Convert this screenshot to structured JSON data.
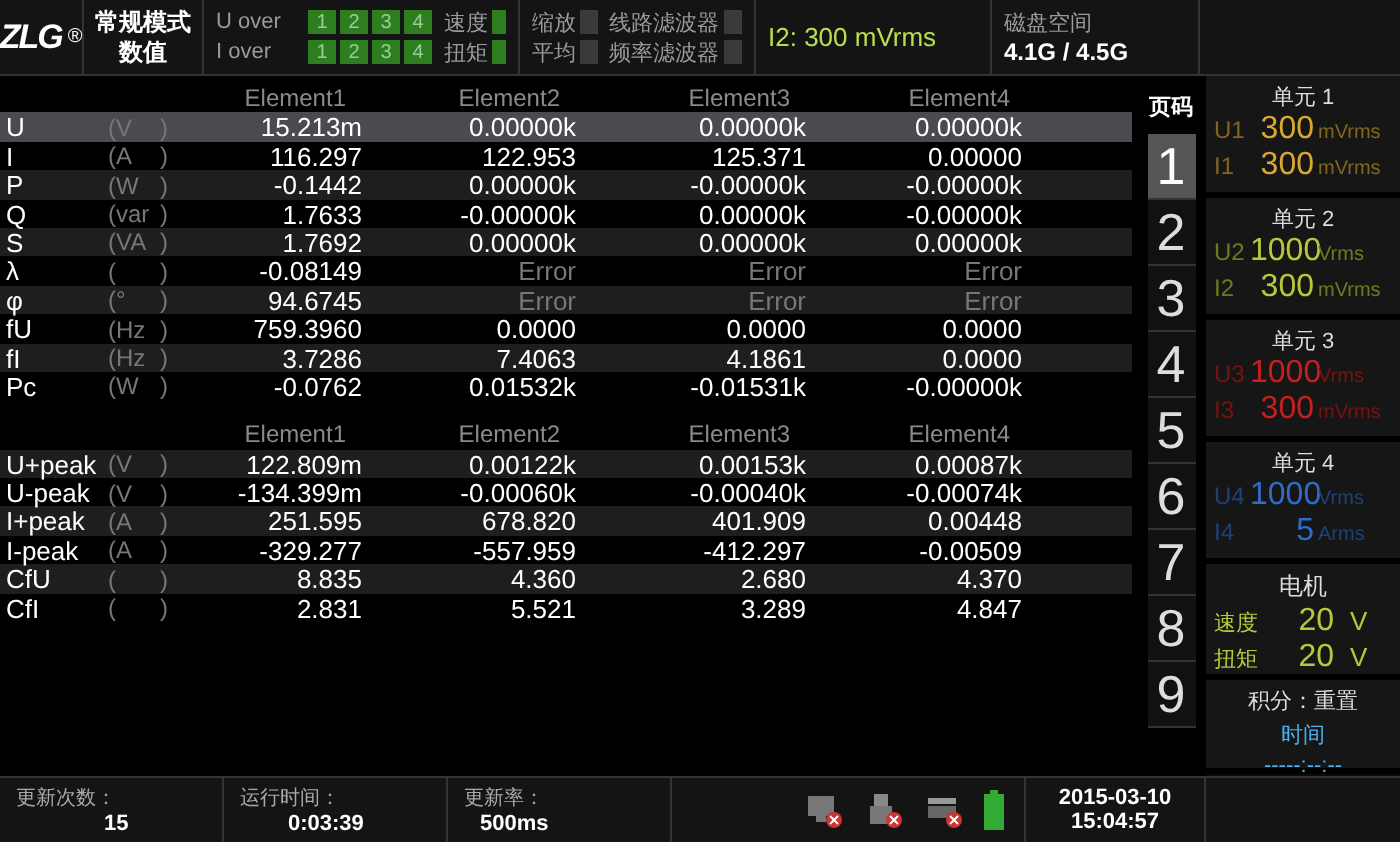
{
  "top_bar": {
    "logo": "ZLG",
    "logo_mark": "®",
    "mode": "常规模式",
    "view": "数值",
    "u_over": {
      "label": "U over",
      "lights": [
        {
          "text": "1",
          "on": true
        },
        {
          "text": "2",
          "on": true
        },
        {
          "text": "3",
          "on": true
        },
        {
          "text": "4",
          "on": true
        }
      ]
    },
    "i_over": {
      "label": "I over",
      "lights": [
        {
          "text": "1",
          "on": true
        },
        {
          "text": "2",
          "on": true
        },
        {
          "text": "3",
          "on": true
        },
        {
          "text": "4",
          "on": true
        }
      ]
    },
    "speed": {
      "label": "速度",
      "on": true
    },
    "torque": {
      "label": "扭矩",
      "on": true
    },
    "flags": [
      {
        "label": "缩放",
        "on": false
      },
      {
        "label": "线路滤波器",
        "on": false
      },
      {
        "label": "平均",
        "on": false
      },
      {
        "label": "频率滤波器",
        "on": false
      }
    ],
    "range": "I2: 300 mVrms",
    "disk_label": "磁盘空间",
    "disk_value": "4.1G / 4.5G"
  },
  "sections": [
    {
      "columns": [
        "Element1",
        "Element2",
        "Element3",
        "Element4"
      ],
      "rows": [
        {
          "name": "U",
          "unit": "(V",
          "close": ")",
          "selected": true,
          "cells": [
            {
              "text": "15.213m",
              "error": false
            },
            {
              "text": "0.00000k",
              "error": false
            },
            {
              "text": "0.00000k",
              "error": false
            },
            {
              "text": "0.00000k",
              "error": false
            }
          ]
        },
        {
          "name": "I",
          "unit": "(A",
          "close": ")",
          "selected": false,
          "cells": [
            {
              "text": "116.297",
              "error": false
            },
            {
              "text": "122.953",
              "error": false
            },
            {
              "text": "125.371",
              "error": false
            },
            {
              "text": "0.00000",
              "error": false
            }
          ]
        },
        {
          "name": "P",
          "unit": "(W",
          "close": ")",
          "selected": false,
          "cells": [
            {
              "text": "-0.1442",
              "error": false
            },
            {
              "text": "0.00000k",
              "error": false
            },
            {
              "text": "-0.00000k",
              "error": false
            },
            {
              "text": "-0.00000k",
              "error": false
            }
          ]
        },
        {
          "name": "Q",
          "unit": "(var",
          "close": ")",
          "selected": false,
          "cells": [
            {
              "text": "1.7633",
              "error": false
            },
            {
              "text": "-0.00000k",
              "error": false
            },
            {
              "text": "0.00000k",
              "error": false
            },
            {
              "text": "-0.00000k",
              "error": false
            }
          ]
        },
        {
          "name": "S",
          "unit": "(VA",
          "close": ")",
          "selected": false,
          "cells": [
            {
              "text": "1.7692",
              "error": false
            },
            {
              "text": "0.00000k",
              "error": false
            },
            {
              "text": "0.00000k",
              "error": false
            },
            {
              "text": "0.00000k",
              "error": false
            }
          ]
        },
        {
          "name": "λ",
          "unit": "(",
          "close": ")",
          "selected": false,
          "cells": [
            {
              "text": "-0.08149",
              "error": false
            },
            {
              "text": "Error",
              "error": true
            },
            {
              "text": "Error",
              "error": true
            },
            {
              "text": "Error",
              "error": true
            }
          ]
        },
        {
          "name": "φ",
          "unit": "(°",
          "close": ")",
          "selected": false,
          "cells": [
            {
              "text": "94.6745",
              "error": false
            },
            {
              "text": "Error",
              "error": true
            },
            {
              "text": "Error",
              "error": true
            },
            {
              "text": "Error",
              "error": true
            }
          ]
        },
        {
          "name": "fU",
          "unit": "(Hz",
          "close": ")",
          "selected": false,
          "cells": [
            {
              "text": "759.3960",
              "error": false
            },
            {
              "text": "0.0000",
              "error": false
            },
            {
              "text": "0.0000",
              "error": false
            },
            {
              "text": "0.0000",
              "error": false
            }
          ]
        },
        {
          "name": "fI",
          "unit": "(Hz",
          "close": ")",
          "selected": false,
          "cells": [
            {
              "text": "3.7286",
              "error": false
            },
            {
              "text": "7.4063",
              "error": false
            },
            {
              "text": "4.1861",
              "error": false
            },
            {
              "text": "0.0000",
              "error": false
            }
          ]
        },
        {
          "name": "Pc",
          "unit": "(W",
          "close": ")",
          "selected": false,
          "cells": [
            {
              "text": "-0.0762",
              "error": false
            },
            {
              "text": "0.01532k",
              "error": false
            },
            {
              "text": "-0.01531k",
              "error": false
            },
            {
              "text": "-0.00000k",
              "error": false
            }
          ]
        }
      ]
    },
    {
      "columns": [
        "Element1",
        "Element2",
        "Element3",
        "Element4"
      ],
      "rows": [
        {
          "name": "U+peak",
          "unit": "(V",
          "close": ")",
          "selected": false,
          "cells": [
            {
              "text": "122.809m",
              "error": false
            },
            {
              "text": "0.00122k",
              "error": false
            },
            {
              "text": "0.00153k",
              "error": false
            },
            {
              "text": "0.00087k",
              "error": false
            }
          ]
        },
        {
          "name": "U-peak",
          "unit": "(V",
          "close": ")",
          "selected": false,
          "cells": [
            {
              "text": "-134.399m",
              "error": false
            },
            {
              "text": "-0.00060k",
              "error": false
            },
            {
              "text": "-0.00040k",
              "error": false
            },
            {
              "text": "-0.00074k",
              "error": false
            }
          ]
        },
        {
          "name": "I+peak",
          "unit": "(A",
          "close": ")",
          "selected": false,
          "cells": [
            {
              "text": "251.595",
              "error": false
            },
            {
              "text": "678.820",
              "error": false
            },
            {
              "text": "401.909",
              "error": false
            },
            {
              "text": "0.00448",
              "error": false
            }
          ]
        },
        {
          "name": "I-peak",
          "unit": "(A",
          "close": ")",
          "selected": false,
          "cells": [
            {
              "text": "-329.277",
              "error": false
            },
            {
              "text": "-557.959",
              "error": false
            },
            {
              "text": "-412.297",
              "error": false
            },
            {
              "text": "-0.00509",
              "error": false
            }
          ]
        },
        {
          "name": "CfU",
          "unit": "(",
          "close": ")",
          "selected": false,
          "cells": [
            {
              "text": "8.835",
              "error": false
            },
            {
              "text": "4.360",
              "error": false
            },
            {
              "text": "2.680",
              "error": false
            },
            {
              "text": "4.370",
              "error": false
            }
          ]
        },
        {
          "name": "CfI",
          "unit": "(",
          "close": ")",
          "selected": false,
          "cells": [
            {
              "text": "2.831",
              "error": false
            },
            {
              "text": "5.521",
              "error": false
            },
            {
              "text": "3.289",
              "error": false
            },
            {
              "text": "4.847",
              "error": false
            }
          ]
        }
      ]
    }
  ],
  "pages": {
    "title": "页码",
    "items": [
      {
        "label": "1",
        "selected": true
      },
      {
        "label": "2",
        "selected": false
      },
      {
        "label": "3",
        "selected": false
      },
      {
        "label": "4",
        "selected": false
      },
      {
        "label": "5",
        "selected": false
      },
      {
        "label": "6",
        "selected": false
      },
      {
        "label": "7",
        "selected": false
      },
      {
        "label": "8",
        "selected": false
      },
      {
        "label": "9",
        "selected": false
      }
    ]
  },
  "units": [
    {
      "title": "单元 1",
      "color": "#d8a830",
      "lines": [
        {
          "label": "U1",
          "value": "300",
          "unit": "mVrms"
        },
        {
          "label": "I1",
          "value": "300",
          "unit": "mVrms"
        }
      ]
    },
    {
      "title": "单元 2",
      "color": "#b8c83a",
      "lines": [
        {
          "label": "U2",
          "value": "1000",
          "unit": "Vrms"
        },
        {
          "label": "I2",
          "value": "300",
          "unit": "mVrms"
        }
      ]
    },
    {
      "title": "单元 3",
      "color": "#c81e1e",
      "lines": [
        {
          "label": "U3",
          "value": "1000",
          "unit": "Vrms"
        },
        {
          "label": "I3",
          "value": "300",
          "unit": "mVrms"
        }
      ]
    },
    {
      "title": "单元 4",
      "color": "#2f6cc8",
      "lines": [
        {
          "label": "U4",
          "value": "1000",
          "unit": "Vrms"
        },
        {
          "label": "I4",
          "value": "5",
          "unit": "Arms"
        }
      ]
    }
  ],
  "motor": {
    "title": "电机",
    "lines": [
      {
        "label": "速度",
        "value": "20",
        "unit": "V"
      },
      {
        "label": "扭矩",
        "value": "20",
        "unit": "V"
      }
    ]
  },
  "integration": {
    "title": "积分：重置",
    "label": "时间",
    "value": "-----:--:--"
  },
  "status_bar": {
    "fields": [
      {
        "label": "更新次数：",
        "value": "15"
      },
      {
        "label": "运行时间：",
        "value": "0:03:39"
      },
      {
        "label": "更新率：",
        "value": "500ms"
      }
    ],
    "date": "2015-03-10",
    "time": "15:04:57"
  }
}
